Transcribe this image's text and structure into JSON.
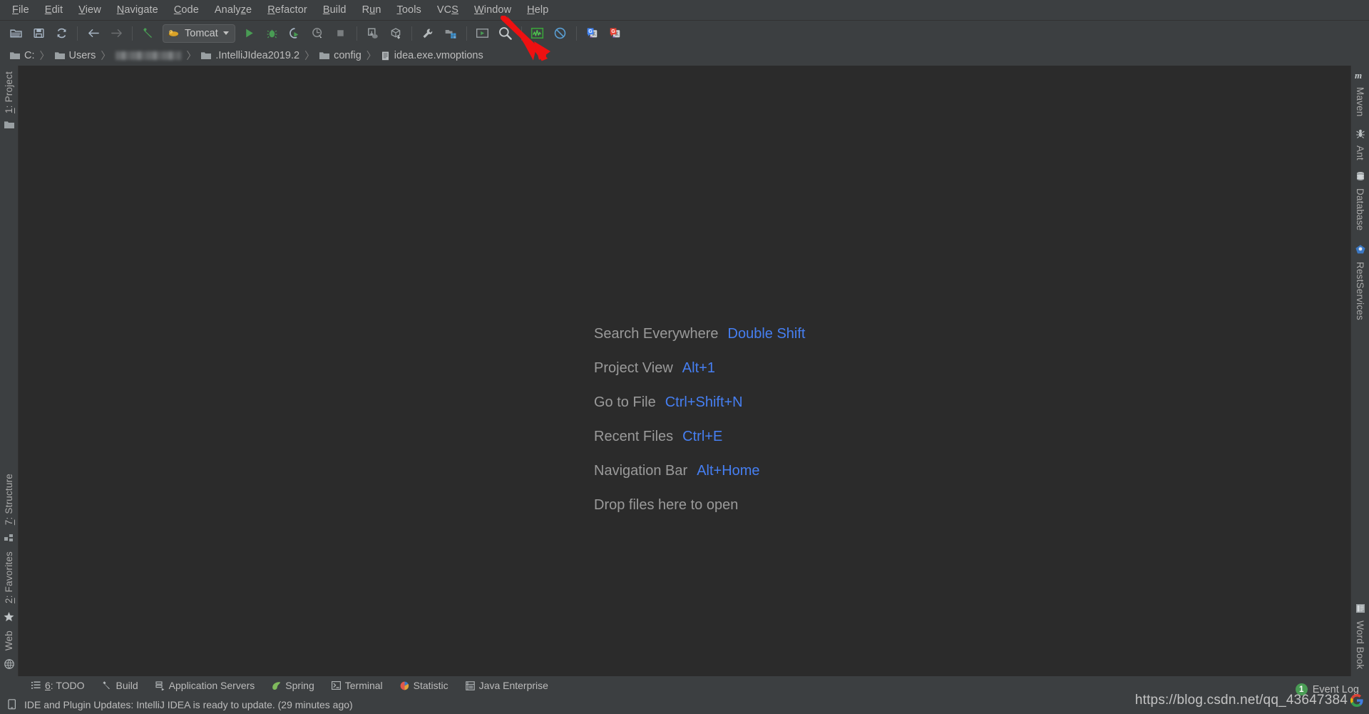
{
  "app": {
    "theme_bg": "#3c3f41",
    "editor_bg": "#2b2b2b",
    "accent_blue": "#467ff2",
    "accent_green": "#499c54"
  },
  "menubar": {
    "items": [
      {
        "label": "File",
        "mnemonic": "F"
      },
      {
        "label": "Edit",
        "mnemonic": "E"
      },
      {
        "label": "View",
        "mnemonic": "V"
      },
      {
        "label": "Navigate",
        "mnemonic": "N"
      },
      {
        "label": "Code",
        "mnemonic": "C"
      },
      {
        "label": "Analyze",
        "mnemonic": "z"
      },
      {
        "label": "Refactor",
        "mnemonic": "R"
      },
      {
        "label": "Build",
        "mnemonic": "B"
      },
      {
        "label": "Run",
        "mnemonic": "u"
      },
      {
        "label": "Tools",
        "mnemonic": "T"
      },
      {
        "label": "VCS",
        "mnemonic": "S"
      },
      {
        "label": "Window",
        "mnemonic": "W"
      },
      {
        "label": "Help",
        "mnemonic": "H"
      }
    ]
  },
  "toolbar": {
    "open_label": "Open",
    "save_label": "Save All",
    "sync_label": "Synchronize",
    "back_label": "Back",
    "forward_label": "Forward",
    "build_label": "Build Project",
    "run_config": {
      "name": "Tomcat",
      "icon": "tomcat-icon"
    },
    "run_label": "Run",
    "debug_label": "Debug",
    "run_coverage_label": "Run with Coverage",
    "profile_label": "Profile",
    "stop_label": "Stop",
    "update_app_label": "Update Application",
    "deploy_label": "Deploy",
    "settings_label": "Settings",
    "project_structure_label": "Project Structure",
    "new_ui_label": "Presentation",
    "search_label": "Search Everywhere",
    "chart_label": "Statistic",
    "block_label": "Disable Plugin",
    "translate_blue_label": "Google Translate",
    "translate_red_label": "Translate Reverse"
  },
  "breadcrumb": {
    "items": [
      {
        "label": "C:",
        "icon": "folder-icon",
        "redacted": false
      },
      {
        "label": "Users",
        "icon": "folder-icon",
        "redacted": false
      },
      {
        "label": "",
        "icon": "none",
        "redacted": true
      },
      {
        "label": ".IntelliJIdea2019.2",
        "icon": "folder-icon",
        "redacted": false
      },
      {
        "label": "config",
        "icon": "folder-icon",
        "redacted": false
      },
      {
        "label": "idea.exe.vmoptions",
        "icon": "file-icon",
        "redacted": false
      }
    ],
    "separator": "〉"
  },
  "left_stripe": {
    "top": [
      {
        "label": "1: Project",
        "mnemonic": "1",
        "icon": "project-folder-icon"
      }
    ],
    "bottom": [
      {
        "label": "7: Structure",
        "mnemonic": "7",
        "icon": "structure-icon"
      },
      {
        "label": "2: Favorites",
        "mnemonic": "2",
        "icon": "star-icon"
      },
      {
        "label": "Web",
        "mnemonic": "",
        "icon": "globe-icon"
      }
    ]
  },
  "right_stripe": {
    "top": [
      {
        "label": "Maven",
        "icon": "maven-icon"
      },
      {
        "label": "Ant",
        "icon": "ant-icon"
      },
      {
        "label": "Database",
        "icon": "database-icon"
      },
      {
        "label": "RestServices",
        "icon": "rest-services-icon"
      }
    ],
    "bottom": [
      {
        "label": "Word Book",
        "icon": "word-book-icon"
      }
    ]
  },
  "editor": {
    "hints": [
      {
        "name": "Search Everywhere",
        "key": "Double Shift"
      },
      {
        "name": "Project View",
        "key": "Alt+1"
      },
      {
        "name": "Go to File",
        "key": "Ctrl+Shift+N"
      },
      {
        "name": "Recent Files",
        "key": "Ctrl+E"
      },
      {
        "name": "Navigation Bar",
        "key": "Alt+Home"
      }
    ],
    "drop_text": "Drop files here to open"
  },
  "toolwindow_bar": {
    "items": [
      {
        "label": "6: TODO",
        "mnemonic": "6",
        "icon": "todo-icon"
      },
      {
        "label": "Build",
        "mnemonic": "",
        "icon": "build-hammer-icon"
      },
      {
        "label": "Application Servers",
        "mnemonic": "",
        "icon": "app-servers-icon"
      },
      {
        "label": "Spring",
        "mnemonic": "",
        "icon": "spring-leaf-icon"
      },
      {
        "label": "Terminal",
        "mnemonic": "",
        "icon": "terminal-icon"
      },
      {
        "label": "Statistic",
        "mnemonic": "",
        "icon": "statistic-icon"
      },
      {
        "label": "Java Enterprise",
        "mnemonic": "",
        "icon": "java-enterprise-icon"
      }
    ]
  },
  "statusbar": {
    "message": "IDE and Plugin Updates: IntelliJ IDEA is ready to update. (29 minutes ago)",
    "event_log_label": "Event Log",
    "event_log_count": "1"
  },
  "watermark": {
    "text": "https://blog.csdn.net/qq_43647384"
  },
  "annotation": {
    "type": "red-arrow",
    "points_to": "search-everywhere-toolbar-button"
  }
}
